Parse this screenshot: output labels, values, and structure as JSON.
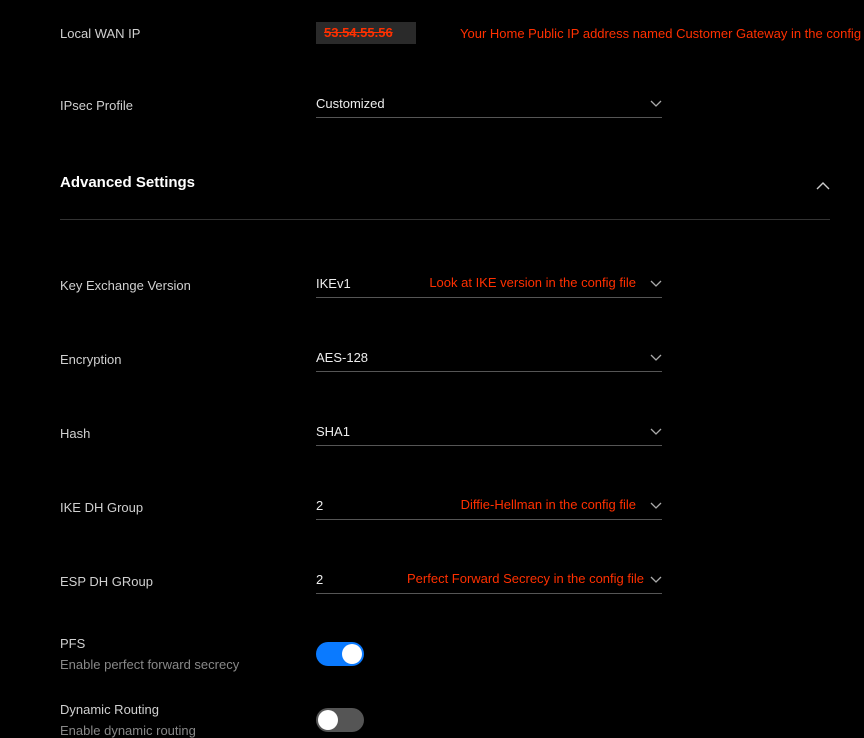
{
  "wanRow": {
    "label": "Local WAN IP",
    "ip": "53.54.55.56",
    "annotation": "Your Home Public IP address named Customer Gateway in the config file"
  },
  "ipsecRow": {
    "label": "IPsec Profile",
    "value": "Customized"
  },
  "section": {
    "title": "Advanced Settings"
  },
  "kev": {
    "label": "Key Exchange Version",
    "value": "IKEv1",
    "annotation": "Look at IKE version in the config file"
  },
  "enc": {
    "label": "Encryption",
    "value": "AES-128"
  },
  "hash": {
    "label": "Hash",
    "value": "SHA1"
  },
  "ikedh": {
    "label": "IKE DH Group",
    "value": "2",
    "annotation": "Diffie-Hellman in the config file"
  },
  "espdh": {
    "label": "ESP DH GRoup",
    "value": "2",
    "annotation": "Perfect Forward Secrecy in the config file"
  },
  "pfs": {
    "label": "PFS",
    "sub": "Enable perfect forward secrecy"
  },
  "dynr": {
    "label": "Dynamic Routing",
    "sub": "Enable dynamic routing"
  }
}
